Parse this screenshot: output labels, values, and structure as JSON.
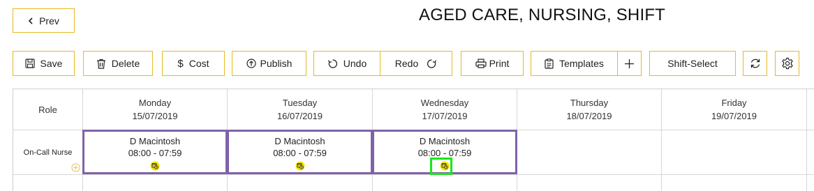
{
  "header": {
    "title": "AGED CARE, NURSING, SHIFT",
    "prev_label": "Prev"
  },
  "toolbar": {
    "save_label": "Save",
    "delete_label": "Delete",
    "cost_label": "Cost",
    "publish_label": "Publish",
    "undo_label": "Undo",
    "redo_label": "Redo",
    "print_label": "Print",
    "templates_label": "Templates",
    "shift_select_label": "Shift-Select"
  },
  "roster": {
    "role_header": "Role",
    "days": [
      {
        "name": "Monday",
        "date": "15/07/2019"
      },
      {
        "name": "Tuesday",
        "date": "16/07/2019"
      },
      {
        "name": "Wednesday",
        "date": "17/07/2019"
      },
      {
        "name": "Thursday",
        "date": "18/07/2019"
      },
      {
        "name": "Friday",
        "date": "19/07/2019"
      }
    ],
    "rows": [
      {
        "role": "On-Call Nurse",
        "shifts": [
          {
            "name": "D Macintosh",
            "time": "08:00 - 07:59"
          },
          {
            "name": "D Macintosh",
            "time": "08:00 - 07:59"
          },
          {
            "name": "D Macintosh",
            "time": "08:00 - 07:59"
          }
        ]
      }
    ]
  },
  "colors": {
    "button_border": "#e8b923",
    "shift_border": "#8062a8",
    "badge": "#f5e600",
    "highlight": "#19e619",
    "add_icon": "#e8c547"
  }
}
